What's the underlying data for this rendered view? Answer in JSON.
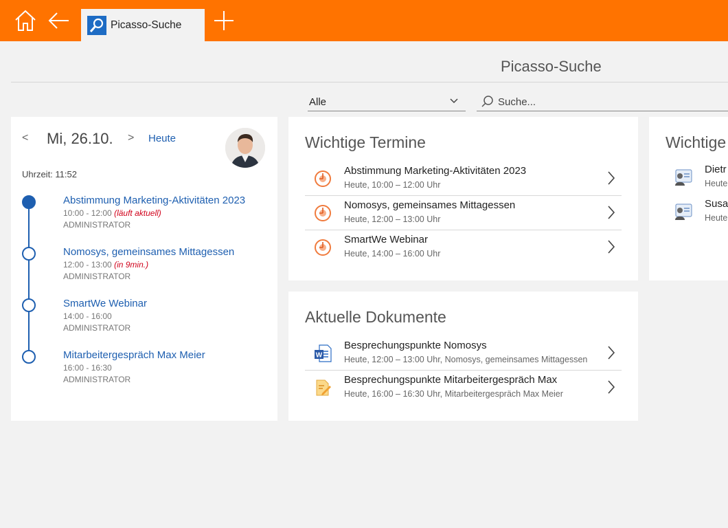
{
  "colors": {
    "accent": "#ff7300",
    "link": "#1e5fb0",
    "warning": "#d0021b"
  },
  "topbar": {
    "home_icon": "home-icon",
    "back_icon": "back-arrow-icon",
    "add_icon": "plus-icon"
  },
  "tab": {
    "label": "Picasso-Suche",
    "icon": "search-icon"
  },
  "page": {
    "title": "Picasso-Suche",
    "filter": {
      "value": "Alle"
    },
    "search": {
      "placeholder": "Suche..."
    }
  },
  "calendar": {
    "prev": "<",
    "date": "Mi, 26.10.",
    "next": ">",
    "today": "Heute",
    "clock": "Uhrzeit: 11:52",
    "events": [
      {
        "title": "Abstimmung Marketing-Aktivitäten 2023",
        "time": "10:00 - 12:00",
        "note": "(läuft aktuell)",
        "owner": "ADMINISTRATOR"
      },
      {
        "title": "Nomosys, gemeinsames Mittagessen",
        "time": "12:00 - 13:00",
        "note": "(in 9min.)",
        "owner": "ADMINISTRATOR"
      },
      {
        "title": "SmartWe Webinar",
        "time": "14:00 - 16:00",
        "note": "",
        "owner": "ADMINISTRATOR"
      },
      {
        "title": "Mitarbeitergespräch Max Meier",
        "time": "16:00 - 16:30",
        "note": "",
        "owner": "ADMINISTRATOR"
      }
    ]
  },
  "appointments": {
    "title": "Wichtige Termine",
    "items": [
      {
        "title": "Abstimmung Marketing-Aktivitäten 2023",
        "sub": "Heute, 10:00 – 12:00 Uhr"
      },
      {
        "title": "Nomosys, gemeinsames Mittagessen",
        "sub": "Heute, 12:00 – 13:00 Uhr"
      },
      {
        "title": "SmartWe Webinar",
        "sub": "Heute, 14:00 – 16:00 Uhr"
      }
    ]
  },
  "documents": {
    "title": "Aktuelle Dokumente",
    "items": [
      {
        "title": "Besprechungspunkte Nomosys",
        "sub": "Heute, 12:00 – 13:00 Uhr, Nomosys, gemeinsames Mittagessen",
        "icon": "word-document-icon"
      },
      {
        "title": "Besprechungspunkte Mitarbeitergespräch Max",
        "sub": "Heute, 16:00 – 16:30 Uhr, Mitarbeitergespräch Max Meier",
        "icon": "note-edit-icon"
      }
    ]
  },
  "contacts": {
    "title": "Wichtige",
    "items": [
      {
        "name": "Dietr",
        "sub": "Heute"
      },
      {
        "name": "Susa",
        "sub": "Heute"
      }
    ]
  }
}
